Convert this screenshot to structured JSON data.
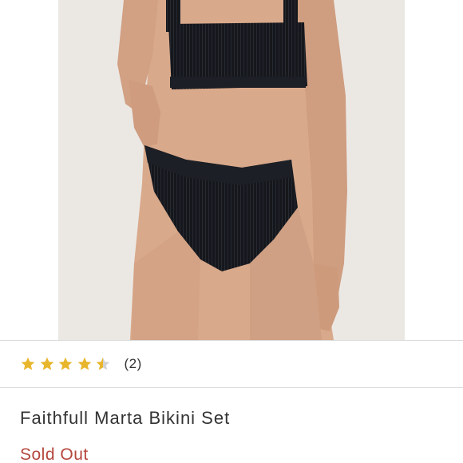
{
  "product": {
    "title": "Faithfull Marta Bikini Set",
    "status": "Sold Out",
    "image": "product-photo"
  },
  "rating": {
    "value": 4.5,
    "max": 5,
    "review_count": "(2)",
    "star_color": "#e8b62c",
    "empty_star_color": "#d3d3d3"
  },
  "colors": {
    "title": "#333333",
    "sold_out": "#b5473c",
    "divider": "#dcdcdc"
  }
}
